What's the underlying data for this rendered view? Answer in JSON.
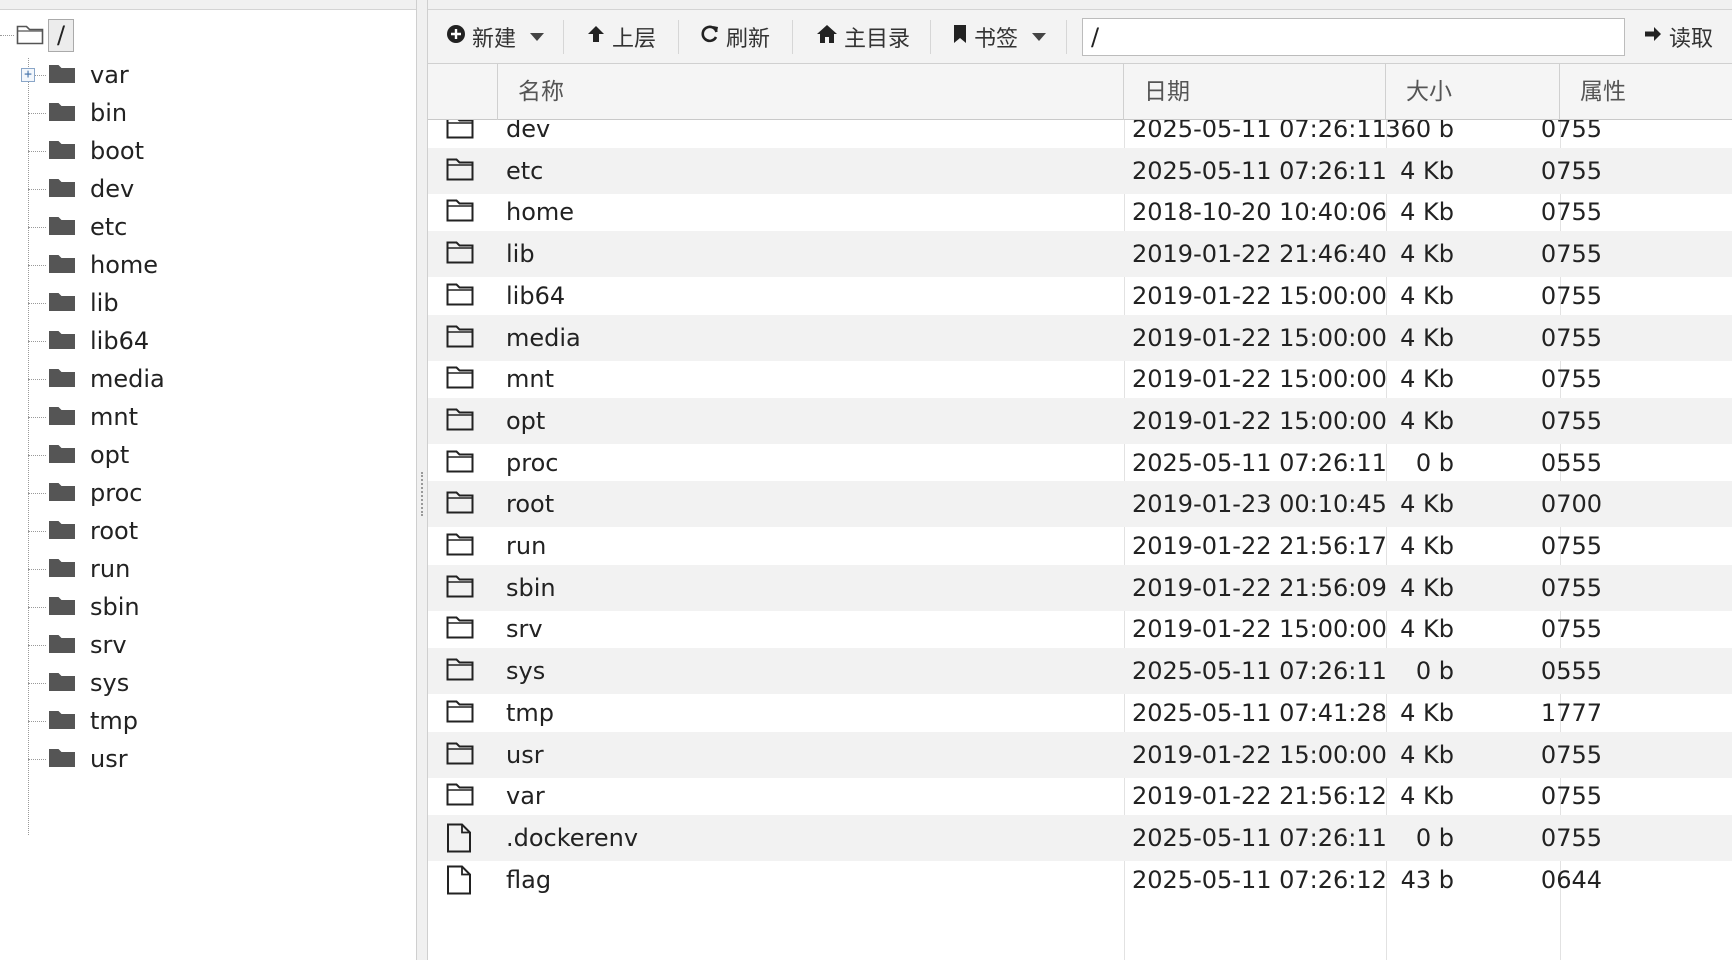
{
  "tree": {
    "root_label": "/",
    "items": [
      {
        "label": "var",
        "expandable": true
      },
      {
        "label": "bin",
        "expandable": false
      },
      {
        "label": "boot",
        "expandable": false
      },
      {
        "label": "dev",
        "expandable": false
      },
      {
        "label": "etc",
        "expandable": false
      },
      {
        "label": "home",
        "expandable": false
      },
      {
        "label": "lib",
        "expandable": false
      },
      {
        "label": "lib64",
        "expandable": false
      },
      {
        "label": "media",
        "expandable": false
      },
      {
        "label": "mnt",
        "expandable": false
      },
      {
        "label": "opt",
        "expandable": false
      },
      {
        "label": "proc",
        "expandable": false
      },
      {
        "label": "root",
        "expandable": false
      },
      {
        "label": "run",
        "expandable": false
      },
      {
        "label": "sbin",
        "expandable": false
      },
      {
        "label": "srv",
        "expandable": false
      },
      {
        "label": "sys",
        "expandable": false
      },
      {
        "label": "tmp",
        "expandable": false
      },
      {
        "label": "usr",
        "expandable": false
      }
    ]
  },
  "toolbar": {
    "new_label": "新建",
    "up_label": "上层",
    "refresh_label": "刷新",
    "home_label": "主目录",
    "bookmark_label": "书签",
    "path_value": "/",
    "read_label": "读取"
  },
  "table": {
    "headers": {
      "name": "名称",
      "date": "日期",
      "size": "大小",
      "attr": "属性"
    },
    "rows": [
      {
        "type": "folder",
        "name": "dev",
        "date": "2025-05-11 07:26:11",
        "size": "360 b",
        "attr": "0755"
      },
      {
        "type": "folder",
        "name": "etc",
        "date": "2025-05-11 07:26:11",
        "size": "4 Kb",
        "attr": "0755"
      },
      {
        "type": "folder",
        "name": "home",
        "date": "2018-10-20 10:40:06",
        "size": "4 Kb",
        "attr": "0755"
      },
      {
        "type": "folder",
        "name": "lib",
        "date": "2019-01-22 21:46:40",
        "size": "4 Kb",
        "attr": "0755"
      },
      {
        "type": "folder",
        "name": "lib64",
        "date": "2019-01-22 15:00:00",
        "size": "4 Kb",
        "attr": "0755"
      },
      {
        "type": "folder",
        "name": "media",
        "date": "2019-01-22 15:00:00",
        "size": "4 Kb",
        "attr": "0755"
      },
      {
        "type": "folder",
        "name": "mnt",
        "date": "2019-01-22 15:00:00",
        "size": "4 Kb",
        "attr": "0755"
      },
      {
        "type": "folder",
        "name": "opt",
        "date": "2019-01-22 15:00:00",
        "size": "4 Kb",
        "attr": "0755"
      },
      {
        "type": "folder",
        "name": "proc",
        "date": "2025-05-11 07:26:11",
        "size": "0 b",
        "attr": "0555"
      },
      {
        "type": "folder",
        "name": "root",
        "date": "2019-01-23 00:10:45",
        "size": "4 Kb",
        "attr": "0700"
      },
      {
        "type": "folder",
        "name": "run",
        "date": "2019-01-22 21:56:17",
        "size": "4 Kb",
        "attr": "0755"
      },
      {
        "type": "folder",
        "name": "sbin",
        "date": "2019-01-22 21:56:09",
        "size": "4 Kb",
        "attr": "0755"
      },
      {
        "type": "folder",
        "name": "srv",
        "date": "2019-01-22 15:00:00",
        "size": "4 Kb",
        "attr": "0755"
      },
      {
        "type": "folder",
        "name": "sys",
        "date": "2025-05-11 07:26:11",
        "size": "0 b",
        "attr": "0555"
      },
      {
        "type": "folder",
        "name": "tmp",
        "date": "2025-05-11 07:41:28",
        "size": "4 Kb",
        "attr": "1777"
      },
      {
        "type": "folder",
        "name": "usr",
        "date": "2019-01-22 15:00:00",
        "size": "4 Kb",
        "attr": "0755"
      },
      {
        "type": "folder",
        "name": "var",
        "date": "2019-01-22 21:56:12",
        "size": "4 Kb",
        "attr": "0755"
      },
      {
        "type": "file",
        "name": ".dockerenv",
        "date": "2025-05-11 07:26:11",
        "size": "0 b",
        "attr": "0755"
      },
      {
        "type": "file",
        "name": "flag",
        "date": "2025-05-11 07:26:12",
        "size": "43 b",
        "attr": "0644"
      }
    ]
  },
  "colors": {
    "row_alt": "#f2f2f2",
    "toolbar_bg": "#f3f3f3",
    "tree_icon": "#555555"
  },
  "icons": {
    "tree_folder": "folder-filled-icon",
    "row_folder": "folder-outline-icon",
    "row_file": "file-outline-icon",
    "new": "plus-circle-icon",
    "up": "arrow-up-icon",
    "refresh": "refresh-icon",
    "home": "home-icon",
    "bookmark": "bookmark-icon",
    "read": "arrow-right-icon",
    "expand": "plus-expander-icon"
  }
}
